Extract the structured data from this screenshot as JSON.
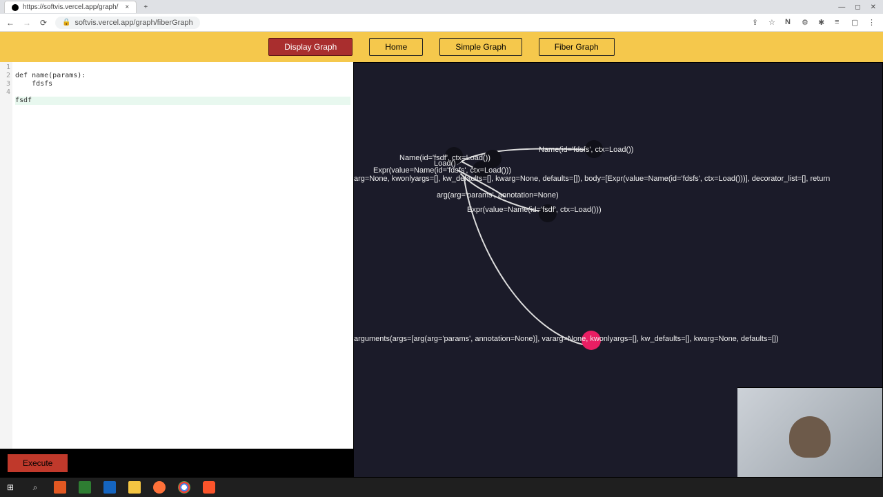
{
  "browser": {
    "tab_title": "https://softvis.vercel.app/graph/",
    "url_display": "softvis.vercel.app/graph/fiberGraph"
  },
  "toolbar": {
    "display_graph": "Display Graph",
    "home": "Home",
    "simple_graph": "Simple Graph",
    "fiber_graph": "Fiber Graph"
  },
  "editor": {
    "lines": {
      "l1": "def name(params):",
      "l2": "    fdsfs",
      "l3": "",
      "l4": "fsdf"
    },
    "line_numbers": {
      "n1": "1",
      "n2": "2",
      "n3": "3",
      "n4": "4"
    }
  },
  "execute_label": "Execute",
  "graph_labels": {
    "a": "Name(id='fdsfs', ctx=Load())",
    "b": "Name(id='fsdf', ctx=Load())",
    "c": "Load()",
    "d": "Name(id='fdsfs', ctx=Load())",
    "e": "Expr(value=Name(id='fdsfs', ctx=Load()))",
    "f": "arg=None, kwonlyargs=[], kw_defaults=[], kwarg=None, defaults=[]), body=[Expr(value=Name(id='fdsfs', ctx=Load()))], decorator_list=[], return",
    "g": "arg(arg='params', annotation=None)",
    "h": "Expr(value=Name(id='fsdf', ctx=Load()))",
    "i": "arguments(args=[arg(arg='params', annotation=None)], vararg=None, kwonlyargs=[], kw_defaults=[], kwarg=None, defaults=[])"
  }
}
